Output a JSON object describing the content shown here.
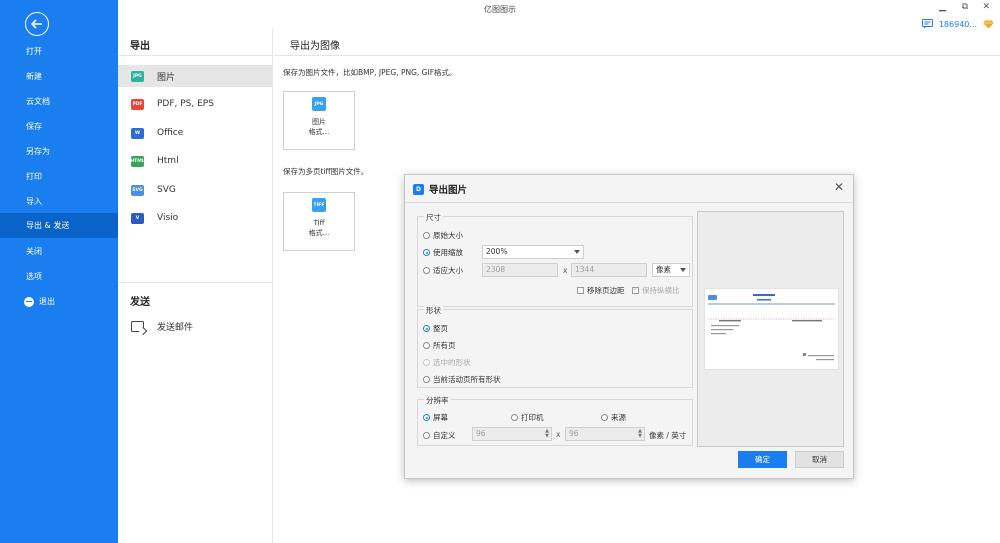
{
  "app": {
    "title": "亿图图示"
  },
  "window": {
    "minimize": "▁",
    "restore": "⧉",
    "close": "✕"
  },
  "user": {
    "id": "186940...",
    "chat_icon": "chat-icon",
    "vip_icon": "diamond-icon"
  },
  "sidebar": {
    "items": [
      {
        "label": "打开"
      },
      {
        "label": "新建"
      },
      {
        "label": "云文档"
      },
      {
        "label": "保存"
      },
      {
        "label": "另存为"
      },
      {
        "label": "打印"
      },
      {
        "label": "导入"
      },
      {
        "label": "导出 & 发送"
      },
      {
        "label": "关闭"
      },
      {
        "label": "选项"
      },
      {
        "label": "退出"
      }
    ],
    "active": "导出 & 发送",
    "colors": {
      "bg": "#1a7ef0",
      "active": "#0a63c9"
    }
  },
  "export_panel": {
    "title": "导出",
    "items": [
      {
        "label": "图片",
        "icon": "JPG",
        "color": "#2bb3a0"
      },
      {
        "label": "PDF, PS, EPS",
        "icon": "PDF",
        "color": "#e8453c"
      },
      {
        "label": "Office",
        "icon": "W",
        "color": "#2b6fd6"
      },
      {
        "label": "Html",
        "icon": "HTML",
        "color": "#37a35a"
      },
      {
        "label": "SVG",
        "icon": "SVG",
        "color": "#4a8fe0"
      },
      {
        "label": "Visio",
        "icon": "V",
        "color": "#2b5cc4"
      }
    ],
    "send_title": "发送",
    "send_items": [
      {
        "label": "发送邮件"
      }
    ]
  },
  "content": {
    "title": "导出为图像",
    "desc1": "保存为图片文件，比如BMP, JPEG, PNG, GIF格式。",
    "tile1": {
      "icon": "JPG",
      "line1": "图片",
      "line2": "格式..."
    },
    "desc2": "保存为多页tiff图片文件。",
    "tile2": {
      "icon": "TIFF",
      "line1": "Tiff",
      "line2": "格式..."
    }
  },
  "dialog": {
    "title": "导出图片",
    "size": {
      "label": "尺寸",
      "original": "原始大小",
      "use_scale": "使用缩放",
      "scale_value": "200%",
      "fit": "适应大小",
      "width": "2308",
      "x": "x",
      "height": "1344",
      "unit": "像素",
      "remove_margin": "移除页边距",
      "keep_ratio": "保持纵横比"
    },
    "shape": {
      "label": "形状",
      "whole_page": "整页",
      "all_pages": "所有页",
      "selected": "选中的形状",
      "current_all": "当前活动页所有形状"
    },
    "resolution": {
      "label": "分辨率",
      "screen": "屏幕",
      "printer": "打印机",
      "source": "来源",
      "custom": "自定义",
      "dpi_x": "96",
      "x": "x",
      "dpi_y": "96",
      "unit": "像素 / 英寸"
    },
    "ok": "确定",
    "cancel": "取消",
    "close": "✕"
  }
}
